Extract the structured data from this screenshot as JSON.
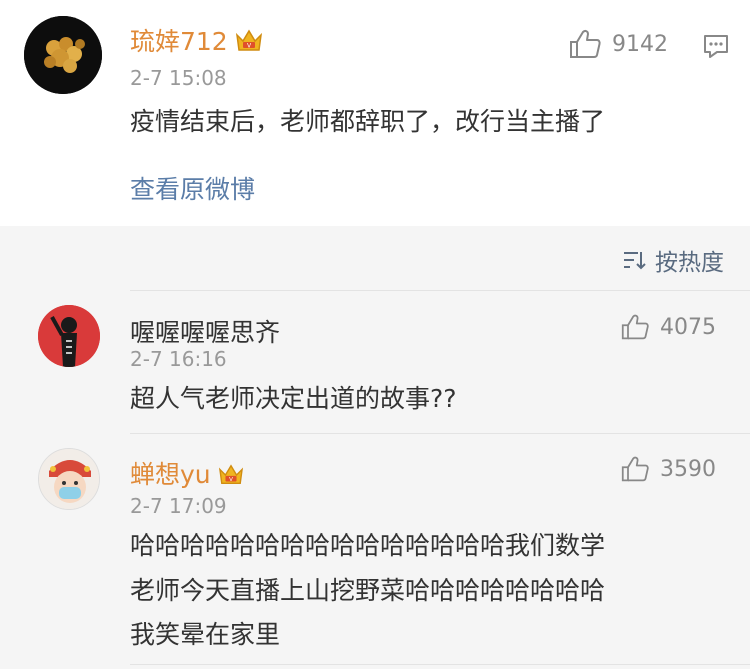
{
  "post": {
    "username": "琉婞712",
    "time": "2-7 15:08",
    "text": "疫情结束后，老师都辞职了，改行当主播了",
    "likes": "9142",
    "view_original": "查看原微博"
  },
  "sort": {
    "label": "按热度"
  },
  "comments": [
    {
      "username": "喔喔喔喔思齐",
      "time": "2-7 16:16",
      "likes": "4075",
      "lines": [
        "超人气老师决定出道的故事??"
      ]
    },
    {
      "username": "蝉想yu",
      "time": "2-7 17:09",
      "likes": "3590",
      "lines": [
        "哈哈哈哈哈哈哈哈哈哈哈哈哈哈哈我们数学",
        "老师今天直播上山挖野菜哈哈哈哈哈哈哈哈",
        "我笑晕在家里"
      ]
    }
  ],
  "colors": {
    "vip_name": "#e08a38",
    "link": "#5b7da8",
    "muted": "#999999"
  }
}
